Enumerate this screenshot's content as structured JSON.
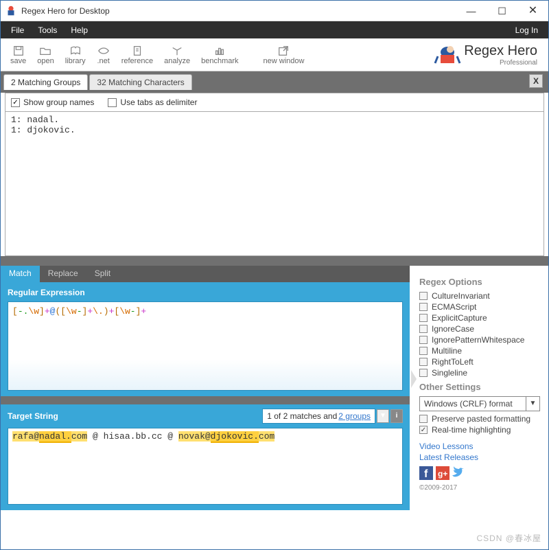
{
  "window": {
    "title": "Regex Hero for Desktop"
  },
  "menu": {
    "file": "File",
    "tools": "Tools",
    "help": "Help",
    "login": "Log In"
  },
  "toolbar": {
    "save": "save",
    "open": "open",
    "library": "library",
    "net": ".net",
    "reference": "reference",
    "analyze": "analyze",
    "benchmark": "benchmark",
    "new_window": "new window"
  },
  "brand": {
    "big": "Regex Hero",
    "small": "Professional"
  },
  "tabs_top": {
    "groups": "2 Matching Groups",
    "chars": "32 Matching Characters",
    "close": "X"
  },
  "options": {
    "show_names": {
      "label": "Show group names",
      "checked": true
    },
    "use_tabs": {
      "label": "Use tabs as delimiter",
      "checked": false
    }
  },
  "output": "1: nadal.\n1: djokovic.",
  "mode_tabs": {
    "match": "Match",
    "replace": "Replace",
    "split": "Split"
  },
  "regex": {
    "label": "Regular Expression",
    "tokens": [
      {
        "t": "[",
        "c": "b"
      },
      {
        "t": "-.",
        "c": "g"
      },
      {
        "t": "\\w",
        "c": "o"
      },
      {
        "t": "]",
        "c": "b"
      },
      {
        "t": "+",
        "c": "p"
      },
      {
        "t": "@",
        "c": "bl"
      },
      {
        "t": "(",
        "c": "b"
      },
      {
        "t": "[",
        "c": "b"
      },
      {
        "t": "\\w",
        "c": "o"
      },
      {
        "t": "-",
        "c": "g"
      },
      {
        "t": "]",
        "c": "b"
      },
      {
        "t": "+",
        "c": "p"
      },
      {
        "t": "\\.",
        "c": "o"
      },
      {
        "t": ")",
        "c": "b"
      },
      {
        "t": "+",
        "c": "p"
      },
      {
        "t": "[",
        "c": "b"
      },
      {
        "t": "\\w",
        "c": "o"
      },
      {
        "t": "-",
        "c": "g"
      },
      {
        "t": "]",
        "c": "b"
      },
      {
        "t": "+",
        "c": "p"
      }
    ]
  },
  "target": {
    "label": "Target String",
    "status_pre": "1 of 2 matches and ",
    "status_groups": "2 groups",
    "m1_a": "rafa@",
    "m1_b": "nadal.",
    "m1_c": "com",
    "sep1": " @ hisaa.bb.cc @ ",
    "m2_a": "novak@",
    "m2_b": "djokovic.",
    "m2_c": "com"
  },
  "right": {
    "regex_options": "Regex Options",
    "opts": [
      "CultureInvariant",
      "ECMAScript",
      "ExplicitCapture",
      "IgnoreCase",
      "IgnorePatternWhitespace",
      "Multiline",
      "RightToLeft",
      "Singleline"
    ],
    "other_settings": "Other Settings",
    "format_sel": "Windows (CRLF) format",
    "preserve": {
      "label": "Preserve pasted formatting",
      "checked": false
    },
    "realtime": {
      "label": "Real-time highlighting",
      "checked": true
    },
    "links": {
      "video": "Video Lessons",
      "releases": "Latest Releases"
    },
    "copyright": "©2009-2017"
  },
  "watermark": "CSDN @春冰屋"
}
